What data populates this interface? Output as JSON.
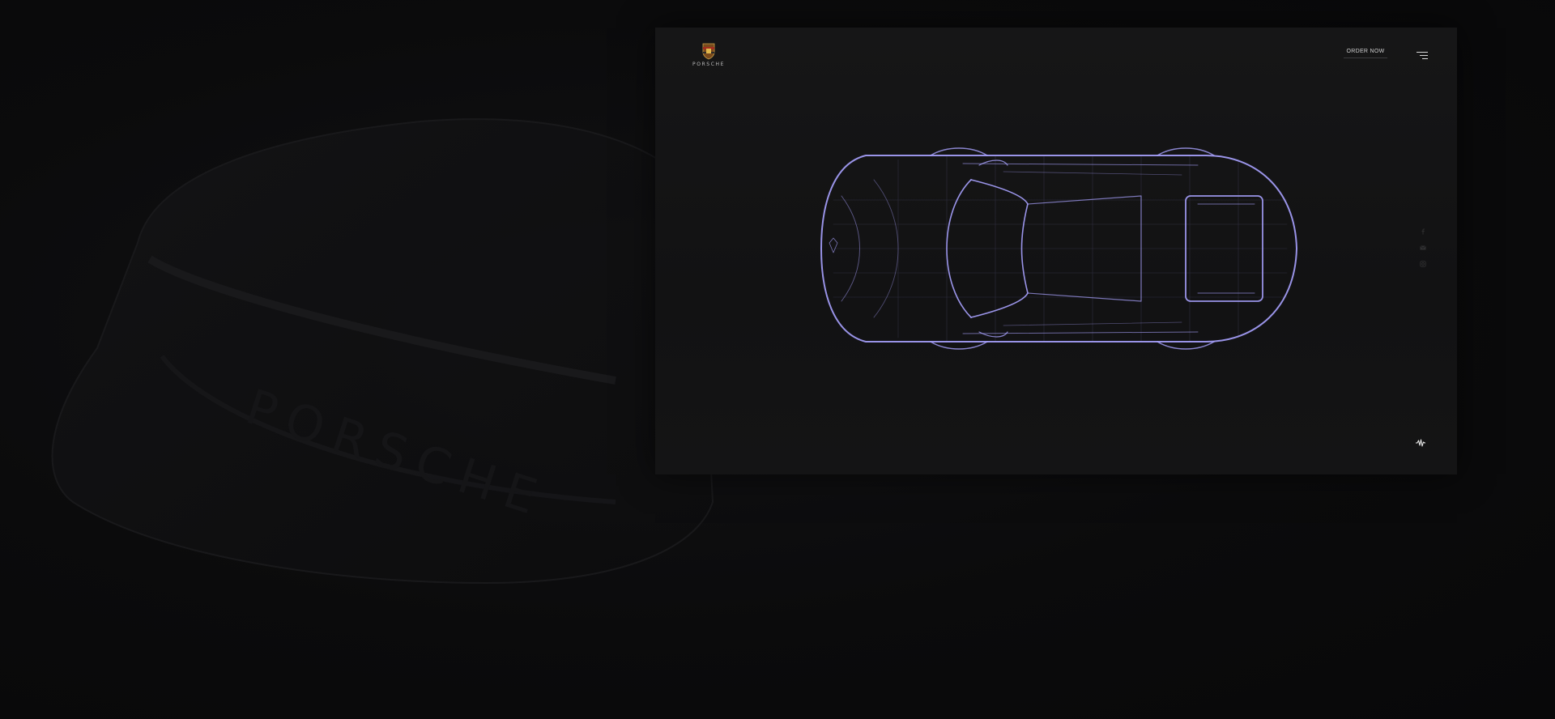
{
  "brand": {
    "wordmark": "PORSCHE",
    "crest_icon": "porsche-crest-icon"
  },
  "header": {
    "order_label": "ORDER NOW",
    "menu_icon": "hamburger-menu-icon"
  },
  "social": {
    "items": [
      {
        "icon": "facebook-icon"
      },
      {
        "icon": "mail-icon"
      },
      {
        "icon": "instagram-icon"
      }
    ]
  },
  "footer": {
    "sound_icon": "sound-wave-icon"
  },
  "colors": {
    "background": "#0a0a0b",
    "panel": "#141415",
    "wireframe": "#a9a2ff",
    "text": "#cfcfcf"
  }
}
